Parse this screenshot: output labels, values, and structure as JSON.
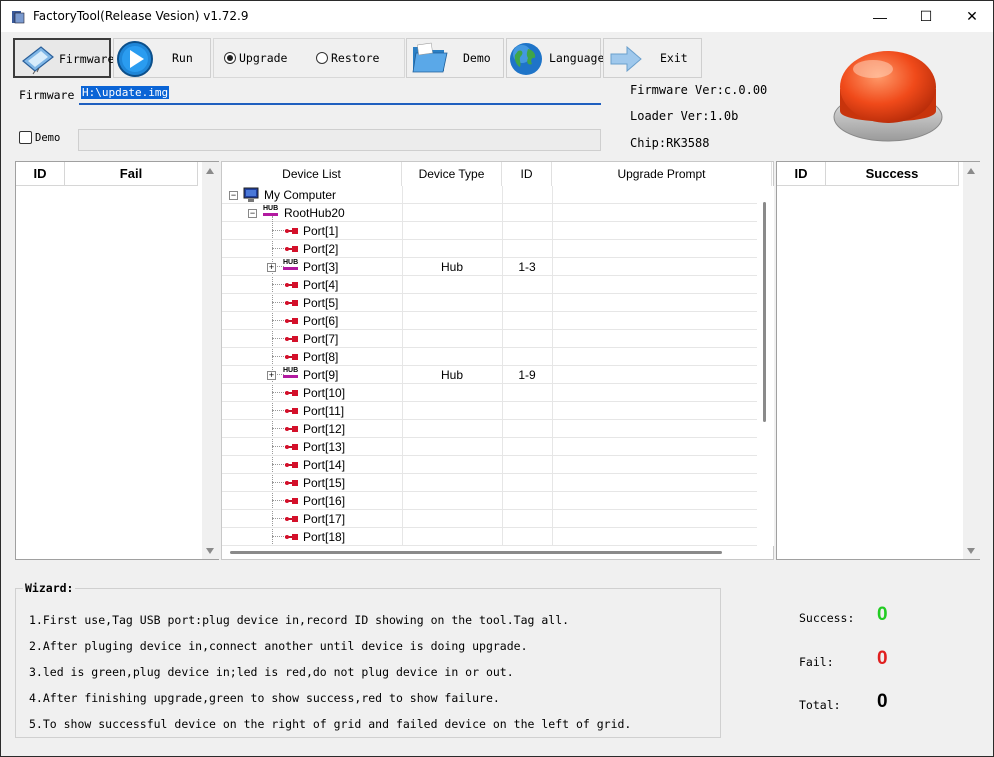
{
  "window": {
    "title": "FactoryTool(Release Vesion) v1.72.9",
    "minimize": "—",
    "maximize": "☐",
    "close": "✕"
  },
  "toolbar": {
    "firmware": "Firmware",
    "run": "Run",
    "upgrade": "Upgrade",
    "restore": "Restore",
    "demo": "Demo",
    "language": "Language",
    "exit": "Exit",
    "mode_selected": "Upgrade"
  },
  "firmware_path": {
    "label": "Firmware",
    "value": "H:\\update.img"
  },
  "demo_option": {
    "label": "Demo",
    "checked": false
  },
  "info": {
    "firmware_ver": "Firmware Ver:c.0.00",
    "loader_ver": "Loader Ver:1.0b",
    "chip": "Chip:RK3588"
  },
  "fail_grid": {
    "col_id": "ID",
    "col_fail": "Fail"
  },
  "success_grid": {
    "col_id": "ID",
    "col_success": "Success"
  },
  "device_grid": {
    "columns": [
      "Device List",
      "Device Type",
      "ID",
      "Upgrade Prompt"
    ],
    "root": "My Computer",
    "hub": "RootHub20",
    "hub_icon_text": "HUB",
    "ports": [
      {
        "name": "Port[1]",
        "type": "",
        "id": "",
        "hub": false
      },
      {
        "name": "Port[2]",
        "type": "",
        "id": "",
        "hub": false
      },
      {
        "name": "Port[3]",
        "type": "Hub",
        "id": "1-3",
        "hub": true
      },
      {
        "name": "Port[4]",
        "type": "",
        "id": "",
        "hub": false
      },
      {
        "name": "Port[5]",
        "type": "",
        "id": "",
        "hub": false
      },
      {
        "name": "Port[6]",
        "type": "",
        "id": "",
        "hub": false
      },
      {
        "name": "Port[7]",
        "type": "",
        "id": "",
        "hub": false
      },
      {
        "name": "Port[8]",
        "type": "",
        "id": "",
        "hub": false
      },
      {
        "name": "Port[9]",
        "type": "Hub",
        "id": "1-9",
        "hub": true
      },
      {
        "name": "Port[10]",
        "type": "",
        "id": "",
        "hub": false
      },
      {
        "name": "Port[11]",
        "type": "",
        "id": "",
        "hub": false
      },
      {
        "name": "Port[12]",
        "type": "",
        "id": "",
        "hub": false
      },
      {
        "name": "Port[13]",
        "type": "",
        "id": "",
        "hub": false
      },
      {
        "name": "Port[14]",
        "type": "",
        "id": "",
        "hub": false
      },
      {
        "name": "Port[15]",
        "type": "",
        "id": "",
        "hub": false
      },
      {
        "name": "Port[16]",
        "type": "",
        "id": "",
        "hub": false
      },
      {
        "name": "Port[17]",
        "type": "",
        "id": "",
        "hub": false
      },
      {
        "name": "Port[18]",
        "type": "",
        "id": "",
        "hub": false
      }
    ]
  },
  "wizard": {
    "title": "Wizard:",
    "lines": [
      "1.First use,Tag USB port:plug device in,record ID showing on the tool.Tag all.",
      "2.After pluging device in,connect another until device is doing upgrade.",
      "3.led is green,plug device in;led is red,do not plug device in or out.",
      "4.After finishing upgrade,green to show success,red to show failure.",
      "5.To show successful device on the right of grid and failed device on the left of grid."
    ]
  },
  "stats": {
    "success_label": "Success:",
    "success_value": "0",
    "fail_label": "Fail:",
    "fail_value": "0",
    "total_label": "Total:",
    "total_value": "0"
  },
  "colors": {
    "success": "#22cc22",
    "fail": "#e02020",
    "selection": "#0a64d6",
    "led": "#f04a1a"
  }
}
